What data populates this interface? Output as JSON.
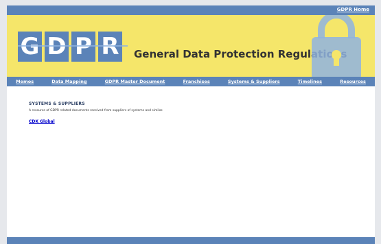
{
  "header": {
    "home_link": "GDPR Home"
  },
  "banner": {
    "logo_letters": [
      "G",
      "D",
      "P",
      "R"
    ],
    "title": "General Data Protection Regulations"
  },
  "nav": {
    "items": [
      {
        "label": "Memos"
      },
      {
        "label": "Data Mapping"
      },
      {
        "label": "GDPR Master Document"
      },
      {
        "label": "Franchises"
      },
      {
        "label": "Systems & Suppliers"
      },
      {
        "label": "Timelines"
      },
      {
        "label": "Resources"
      }
    ]
  },
  "main": {
    "section_title": "SYSTEMS & SUPPLIERS",
    "description": "A resource of GDPR related documents received from suppliers of systems and similar.",
    "links": [
      {
        "label": "CDK Global"
      }
    ]
  },
  "colors": {
    "nav_blue": "#5b83b8",
    "banner_yellow": "#f5e66a"
  }
}
